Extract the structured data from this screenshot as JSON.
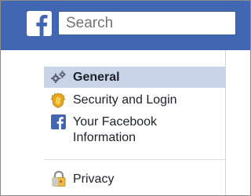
{
  "header": {
    "brand_icon": "facebook-f-logo",
    "search": {
      "placeholder": "Search",
      "value": ""
    },
    "colors": {
      "bar": "#4267b2",
      "logo_bg": "#ffffff"
    }
  },
  "sidebar": {
    "items": [
      {
        "label": "General",
        "icon": "gears-icon",
        "selected": true
      },
      {
        "label": "Security and Login",
        "icon": "shield-badge-icon",
        "selected": false
      },
      {
        "label": "Your Facebook Information",
        "icon": "facebook-icon",
        "selected": false
      },
      {
        "label": "Privacy",
        "icon": "lock-icon",
        "selected": false
      }
    ],
    "colors": {
      "selected_bg": "#c9d4e8",
      "text": "#1d2129"
    }
  }
}
